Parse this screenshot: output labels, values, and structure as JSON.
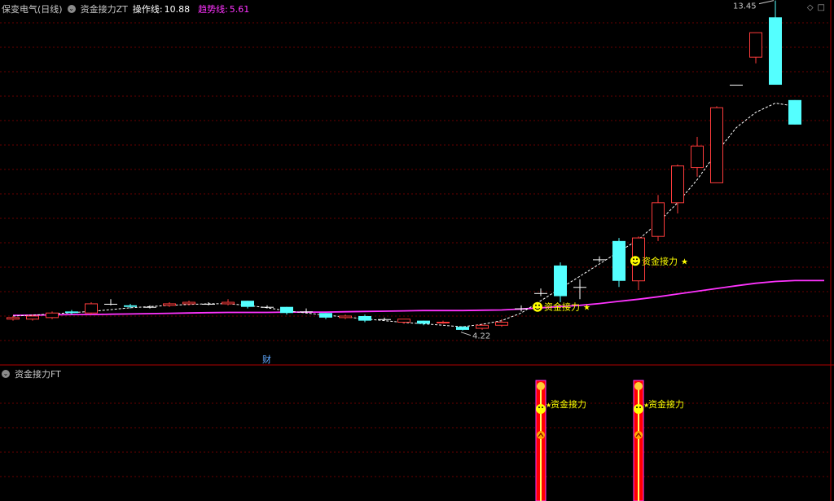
{
  "header": {
    "stock_title": "保变电气(日线)",
    "indicator_name": "资金接力ZT",
    "op_label": "操作线:",
    "op_value": "10.88",
    "trend_label": "趋势线:",
    "trend_value": "5.61",
    "colors": {
      "title": "#c8c8c8",
      "op": "#ffffff",
      "trend": "#ff33ff"
    }
  },
  "sub_header": {
    "indicator_name": "资金接力FT"
  },
  "top_icons": [
    "diamond-icon",
    "square-icon"
  ],
  "chart_data": {
    "type": "candlestick",
    "price_range": [
      3.2,
      14.5
    ],
    "candles": [
      {
        "o": 4.35,
        "c": 4.4,
        "h": 4.45,
        "l": 4.3,
        "dir": "up"
      },
      {
        "o": 4.35,
        "c": 4.45,
        "h": 4.5,
        "l": 4.3,
        "dir": "up"
      },
      {
        "o": 4.4,
        "c": 4.55,
        "h": 4.6,
        "l": 4.35,
        "dir": "up"
      },
      {
        "o": 4.6,
        "c": 4.55,
        "h": 4.65,
        "l": 4.5,
        "dir": "down"
      },
      {
        "o": 4.55,
        "c": 4.85,
        "h": 4.9,
        "l": 4.5,
        "dir": "up"
      },
      {
        "o": 4.85,
        "c": 4.85,
        "h": 5.0,
        "l": 4.8,
        "dir": "flat"
      },
      {
        "o": 4.8,
        "c": 4.75,
        "h": 4.85,
        "l": 4.7,
        "dir": "down"
      },
      {
        "o": 4.75,
        "c": 4.75,
        "h": 4.8,
        "l": 4.7,
        "dir": "flat"
      },
      {
        "o": 4.8,
        "c": 4.85,
        "h": 4.9,
        "l": 4.75,
        "dir": "up"
      },
      {
        "o": 4.85,
        "c": 4.9,
        "h": 4.95,
        "l": 4.8,
        "dir": "up"
      },
      {
        "o": 4.85,
        "c": 4.85,
        "h": 4.9,
        "l": 4.8,
        "dir": "flat"
      },
      {
        "o": 4.85,
        "c": 4.9,
        "h": 5.0,
        "l": 4.8,
        "dir": "up"
      },
      {
        "o": 4.95,
        "c": 4.75,
        "h": 4.95,
        "l": 4.7,
        "dir": "down"
      },
      {
        "o": 4.75,
        "c": 4.75,
        "h": 4.8,
        "l": 4.7,
        "dir": "flat"
      },
      {
        "o": 4.75,
        "c": 4.55,
        "h": 4.75,
        "l": 4.5,
        "dir": "down"
      },
      {
        "o": 4.6,
        "c": 4.6,
        "h": 4.7,
        "l": 4.55,
        "dir": "flat"
      },
      {
        "o": 4.55,
        "c": 4.4,
        "h": 4.55,
        "l": 4.35,
        "dir": "down"
      },
      {
        "o": 4.45,
        "c": 4.4,
        "h": 4.5,
        "l": 4.35,
        "dir": "up"
      },
      {
        "o": 4.45,
        "c": 4.3,
        "h": 4.5,
        "l": 4.25,
        "dir": "down"
      },
      {
        "o": 4.35,
        "c": 4.35,
        "h": 4.4,
        "l": 4.3,
        "dir": "flat"
      },
      {
        "o": 4.35,
        "c": 4.25,
        "h": 4.35,
        "l": 4.2,
        "dir": "up"
      },
      {
        "o": 4.3,
        "c": 4.2,
        "h": 4.3,
        "l": 4.15,
        "dir": "down"
      },
      {
        "o": 4.25,
        "c": 4.25,
        "h": 4.3,
        "l": 4.2,
        "dir": "up"
      },
      {
        "o": 4.1,
        "c": 4.0,
        "h": 4.12,
        "l": 3.98,
        "dir": "down"
      },
      {
        "o": 4.05,
        "c": 4.15,
        "h": 4.2,
        "l": 4.0,
        "dir": "up"
      },
      {
        "o": 4.15,
        "c": 4.25,
        "h": 4.35,
        "l": 4.1,
        "dir": "up"
      },
      {
        "o": 4.7,
        "c": 4.7,
        "h": 4.8,
        "l": 4.6,
        "dir": "flat"
      },
      {
        "o": 5.2,
        "c": 5.2,
        "h": 5.35,
        "l": 5.1,
        "dir": "flat"
      },
      {
        "o": 6.1,
        "c": 5.1,
        "h": 6.2,
        "l": 4.9,
        "dir": "down"
      },
      {
        "o": 5.4,
        "c": 5.4,
        "h": 5.65,
        "l": 5.0,
        "dir": "flat"
      },
      {
        "o": 6.3,
        "c": 6.3,
        "h": 6.4,
        "l": 6.2,
        "dir": "flat"
      },
      {
        "o": 6.9,
        "c": 5.6,
        "h": 7.0,
        "l": 5.4,
        "dir": "down"
      },
      {
        "o": 5.6,
        "c": 7.0,
        "h": 7.05,
        "l": 5.3,
        "dir": "up"
      },
      {
        "o": 7.05,
        "c": 8.15,
        "h": 8.4,
        "l": 6.9,
        "dir": "up"
      },
      {
        "o": 8.15,
        "c": 9.35,
        "h": 9.4,
        "l": 7.8,
        "dir": "up"
      },
      {
        "o": 9.3,
        "c": 10.0,
        "h": 10.3,
        "l": 9.0,
        "dir": "up"
      },
      {
        "o": 8.8,
        "c": 11.25,
        "h": 11.3,
        "l": 8.8,
        "dir": "up"
      },
      {
        "o": 12.0,
        "c": 12.0,
        "h": 12.0,
        "l": 12.0,
        "dir": "flat"
      },
      {
        "o": 12.9,
        "c": 13.7,
        "h": 13.7,
        "l": 12.7,
        "dir": "up"
      },
      {
        "o": 14.2,
        "c": 12.0,
        "h": 14.75,
        "l": 12.0,
        "dir": "down"
      },
      {
        "o": 11.5,
        "c": 10.7,
        "h": 11.5,
        "l": 10.7,
        "dir": "down"
      }
    ],
    "trend_line": [
      4.47,
      4.48,
      4.49,
      4.5,
      4.5,
      4.51,
      4.52,
      4.53,
      4.54,
      4.55,
      4.56,
      4.57,
      4.57,
      4.57,
      4.58,
      4.58,
      4.58,
      4.59,
      4.6,
      4.61,
      4.62,
      4.63,
      4.63,
      4.63,
      4.64,
      4.65,
      4.68,
      4.72,
      4.76,
      4.8,
      4.86,
      4.93,
      5.0,
      5.08,
      5.17,
      5.26,
      5.35,
      5.44,
      5.52,
      5.58,
      5.61
    ],
    "operation_line": [
      4.45,
      4.48,
      4.52,
      4.56,
      4.6,
      4.66,
      4.72,
      4.76,
      4.8,
      4.83,
      4.85,
      4.85,
      4.8,
      4.72,
      4.62,
      4.55,
      4.48,
      4.42,
      4.36,
      4.3,
      4.24,
      4.2,
      4.15,
      4.1,
      4.18,
      4.3,
      4.55,
      4.95,
      5.35,
      5.75,
      6.15,
      6.55,
      6.95,
      7.5,
      8.15,
      8.9,
      9.8,
      10.6,
      11.1,
      11.4,
      11.3
    ],
    "annotations": [
      {
        "text": "13.45",
        "index": 39,
        "value": 14.75,
        "type": "high-marker"
      },
      {
        "text": "4.22",
        "index": 23,
        "value": 3.98,
        "type": "low-marker"
      },
      {
        "text": "财",
        "index": 13,
        "type": "event-marker"
      },
      {
        "text": "资金接力",
        "index": 27,
        "value": 4.75,
        "type": "signal"
      },
      {
        "text": "资金接力",
        "index": 32,
        "value": 6.25,
        "type": "signal"
      }
    ],
    "sub_signals": [
      {
        "index": 27,
        "text": "资金接力"
      },
      {
        "index": 32,
        "text": "资金接力"
      }
    ],
    "colors": {
      "up": "#ff3c3c",
      "down": "#54ffff",
      "flat": "#ffffff",
      "trend": "#ff33ff",
      "operation": "#ffffff",
      "signal": "#ffff00",
      "grid": "#8b0000"
    }
  }
}
